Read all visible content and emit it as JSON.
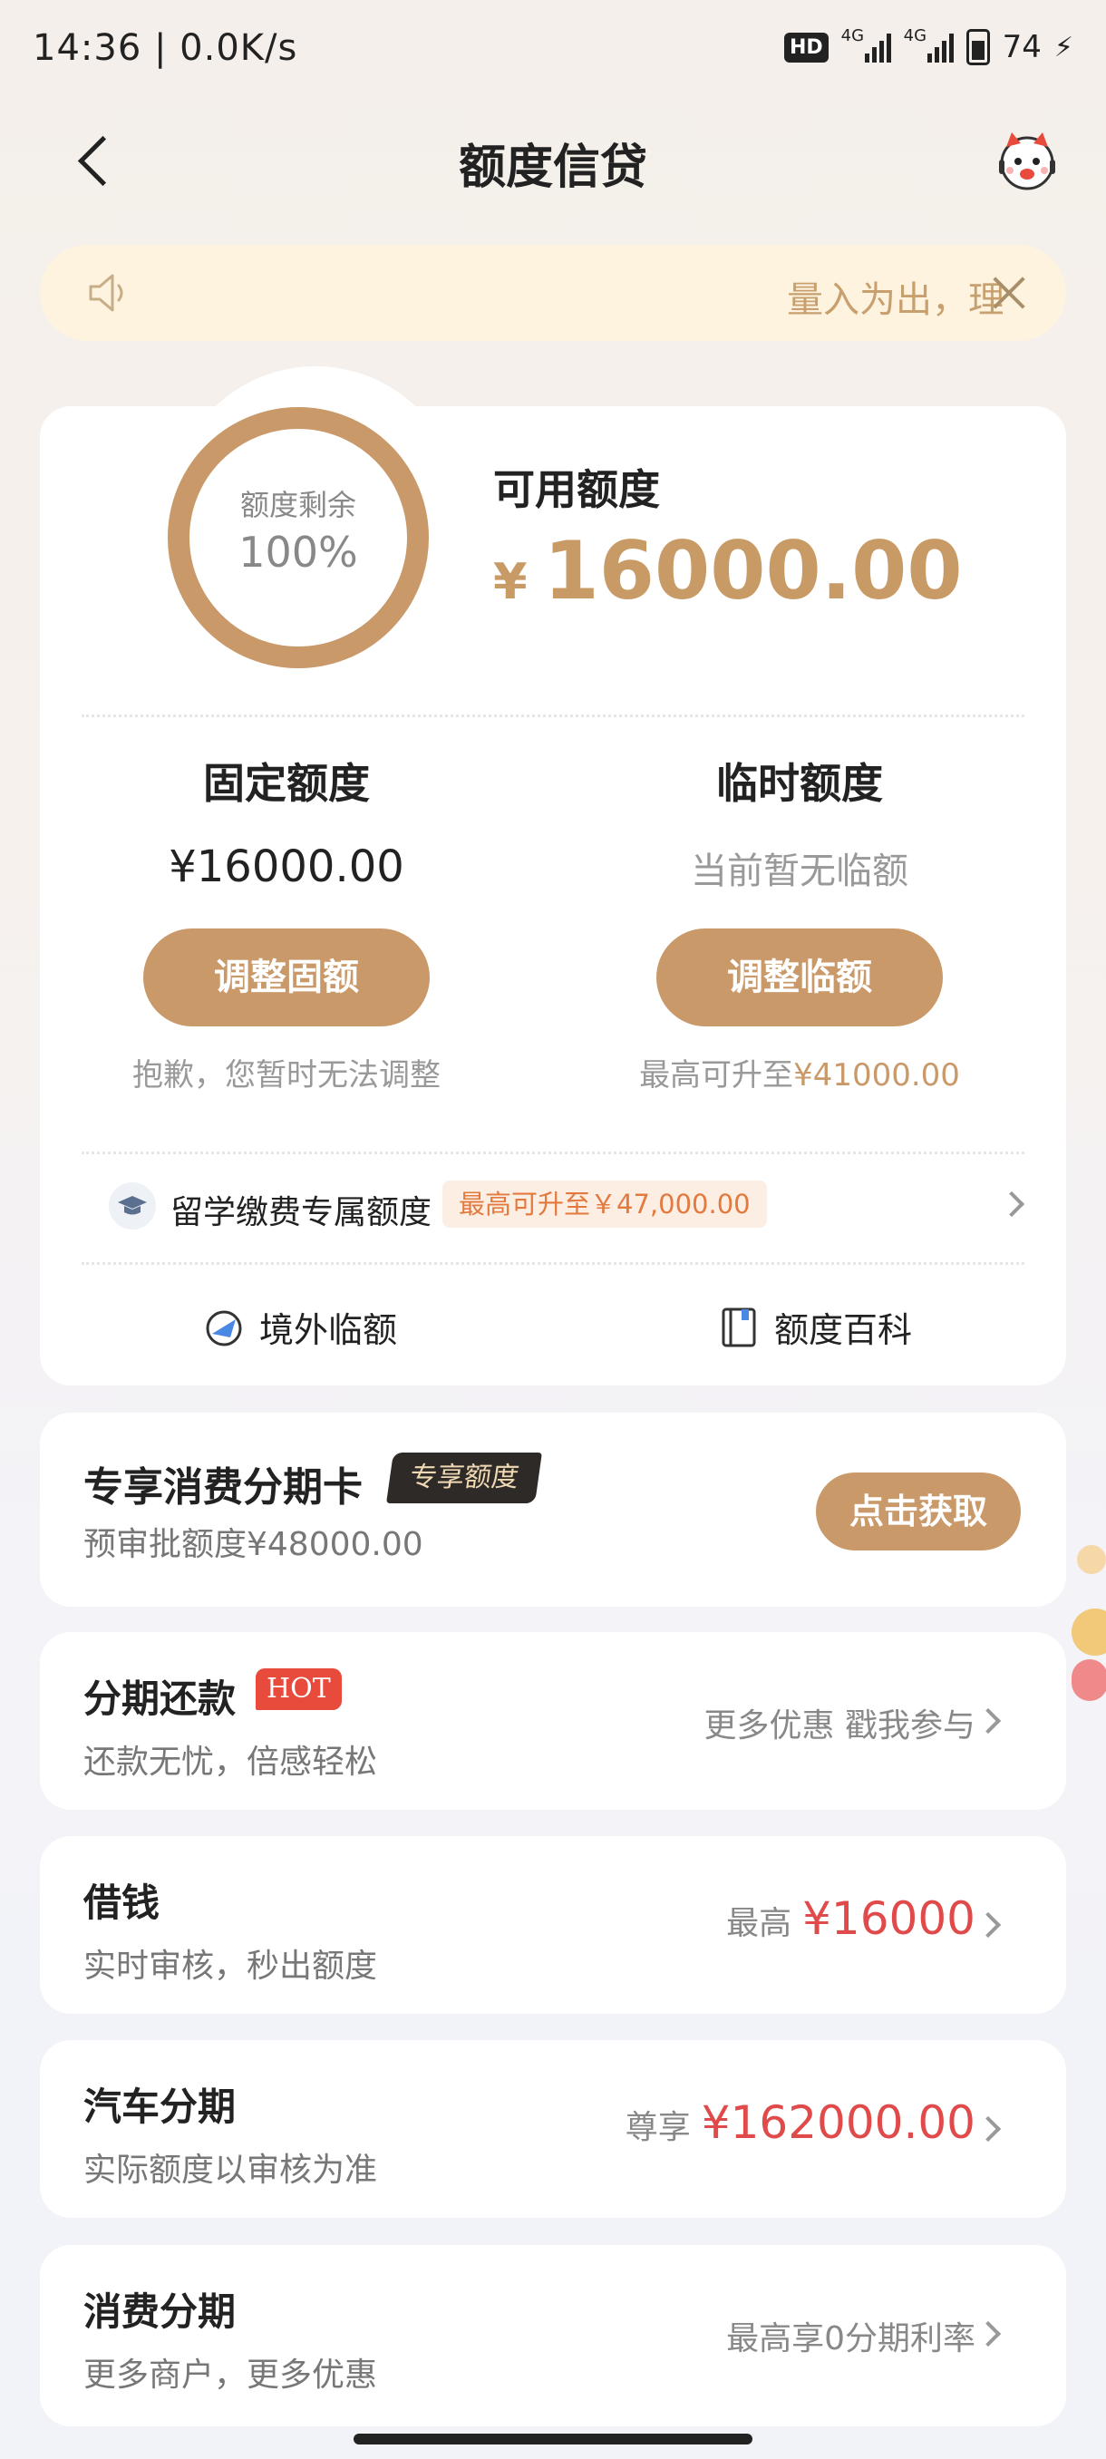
{
  "status_bar": {
    "time": "14:36 | 0.0K/s",
    "hd": "HD",
    "net1": "4G",
    "net2": "4G",
    "battery": "74"
  },
  "nav": {
    "title": "额度信贷",
    "back_icon": "chevron-left-icon",
    "mascot_icon": "mascot-icon"
  },
  "notice": {
    "text": "量入为出，理",
    "icon": "speaker-icon"
  },
  "credit": {
    "ring_label": "额度剩余",
    "ring_value": "100%",
    "ring_fraction": 1.0,
    "available_label": "可用额度",
    "currency": "¥",
    "available_amount": "16000.00",
    "fixed": {
      "title": "固定额度",
      "amount": "¥16000.00",
      "button": "调整固额",
      "note": "抱歉，您暂时无法调整"
    },
    "temporary": {
      "title": "临时额度",
      "status": "当前暂无临额",
      "button": "调整临额",
      "note_prefix": "最高可升至",
      "note_amount": "¥41000.00"
    },
    "study": {
      "label": "留学缴费专属额度",
      "badge": "最高可升至￥47,000.00"
    },
    "links": {
      "overseas": "境外临额",
      "encyclopedia": "额度百科"
    }
  },
  "installment_card": {
    "title": "专享消费分期卡",
    "tag": "专享额度",
    "subtitle": "预审批额度¥48000.00",
    "button": "点击获取"
  },
  "list": [
    {
      "title": "分期还款",
      "badge": "HOT",
      "subtitle": "还款无忧，倍感轻松",
      "right_text": "更多优惠 戳我参与",
      "right_amount": ""
    },
    {
      "title": "借钱",
      "badge": "",
      "subtitle": "实时审核，秒出额度",
      "right_text": "最高",
      "right_amount": "¥16000"
    },
    {
      "title": "汽车分期",
      "badge": "",
      "subtitle": "实际额度以审核为准",
      "right_text": "尊享",
      "right_amount": "¥162000.00"
    },
    {
      "title": "消费分期",
      "badge": "",
      "subtitle": "更多商户，更多优惠",
      "right_text": "最高享0分期利率",
      "right_amount": ""
    }
  ],
  "colors": {
    "gold": "#c9996a",
    "red": "#e04a4a",
    "hot": "#e84a3c"
  }
}
